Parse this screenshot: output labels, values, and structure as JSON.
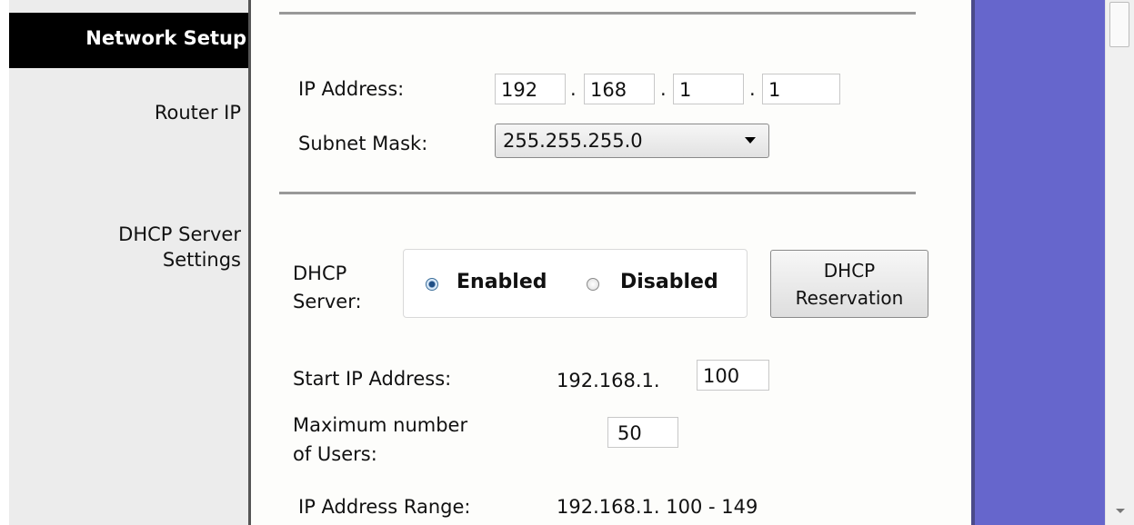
{
  "nav": {
    "title": "Network Setup",
    "sections": {
      "router_ip": "Router IP",
      "dhcp_line1": "DHCP Server",
      "dhcp_line2": "Settings"
    }
  },
  "router_ip": {
    "ip_label": "IP Address:",
    "octets": [
      "192",
      "168",
      "1",
      "1"
    ],
    "separator": ".",
    "subnet_label": "Subnet Mask:",
    "subnet_value": "255.255.255.0"
  },
  "dhcp": {
    "server_label_line1": "DHCP",
    "server_label_line2": "Server:",
    "enabled_label": "Enabled",
    "disabled_label": "Disabled",
    "selected": "Enabled",
    "reservation_line1": "DHCP",
    "reservation_line2": "Reservation",
    "start_ip_label": "Start IP Address:",
    "start_ip_prefix": "192.168.1.",
    "start_ip_value": "100",
    "max_users_line1": "Maximum number",
    "max_users_line2": "of Users:",
    "max_users_value": "50",
    "range_label": "IP Address Range:",
    "range_value": "192.168.1. 100 - 149"
  },
  "colors": {
    "sidebar_header": "#000000",
    "sidebar_bg": "#ececec",
    "right_panel": "#6666cc"
  },
  "icons": {
    "select_arrow": "chevron-down-icon",
    "scroll_down": "scroll-down-arrow-icon"
  }
}
